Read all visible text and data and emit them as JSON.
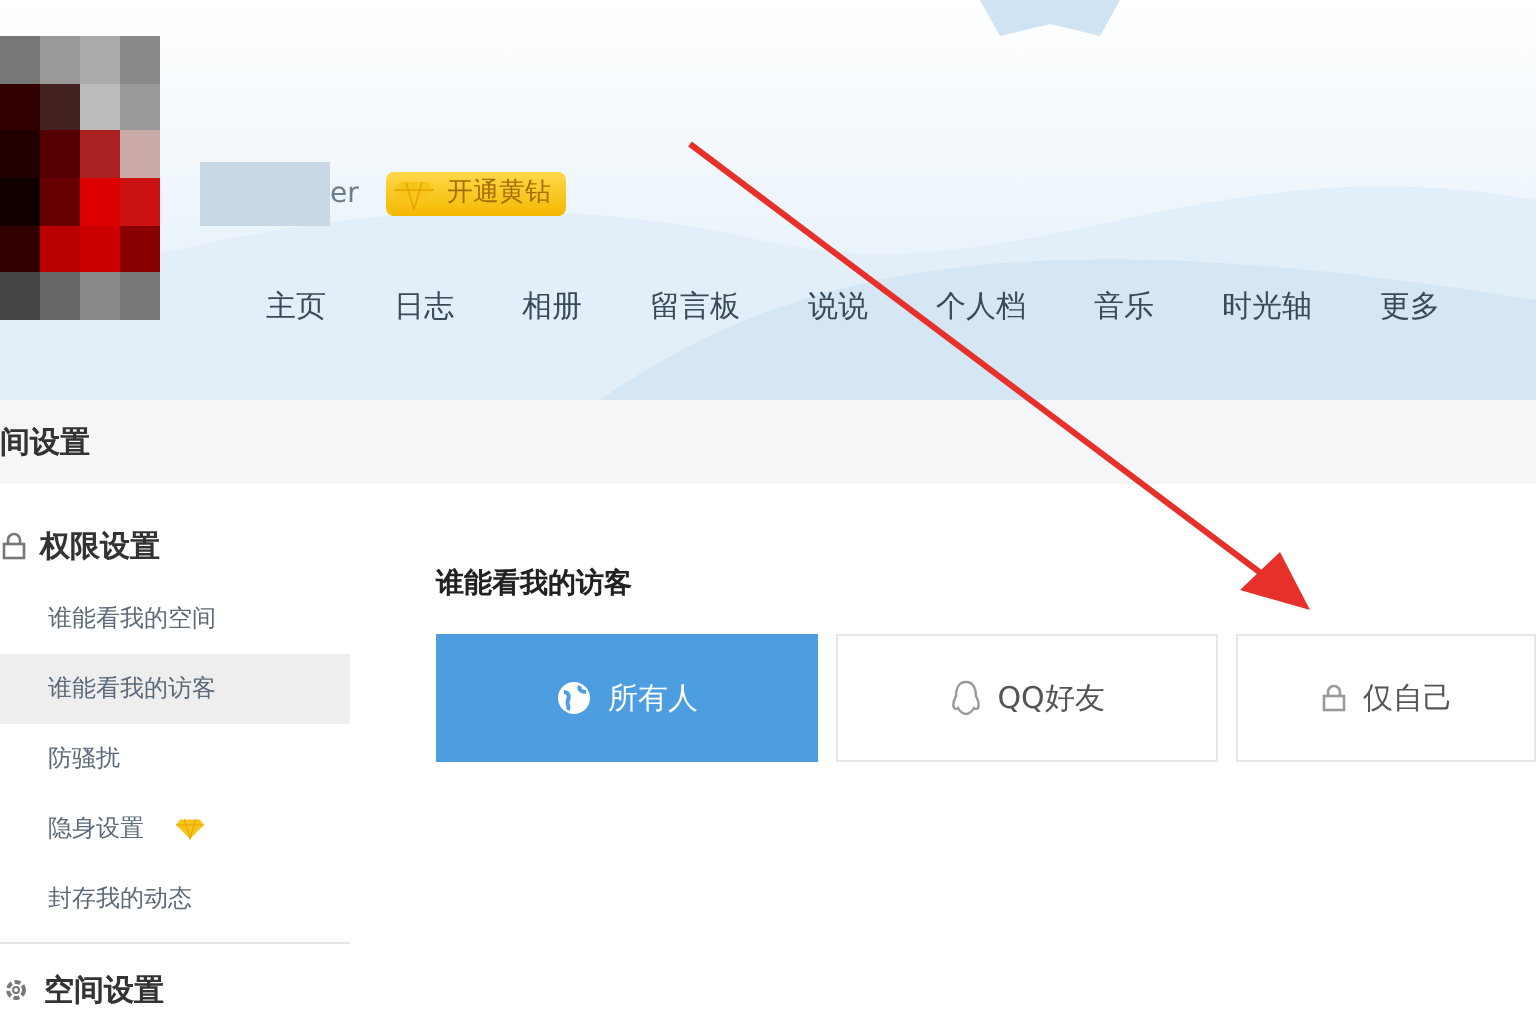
{
  "profile": {
    "name": "er",
    "badge": "开通黄钻"
  },
  "nav": [
    {
      "label": "主页"
    },
    {
      "label": "日志"
    },
    {
      "label": "相册"
    },
    {
      "label": "留言板"
    },
    {
      "label": "说说"
    },
    {
      "label": "个人档"
    },
    {
      "label": "音乐"
    },
    {
      "label": "时光轴"
    },
    {
      "label": "更多"
    }
  ],
  "page_title": "间设置",
  "sidebar": {
    "sections": [
      {
        "title": "权限设置",
        "items": [
          {
            "label": "谁能看我的空间",
            "selected": false,
            "vip": false
          },
          {
            "label": "谁能看我的访客",
            "selected": true,
            "vip": false
          },
          {
            "label": "防骚扰",
            "selected": false,
            "vip": false
          },
          {
            "label": "隐身设置",
            "selected": false,
            "vip": true
          },
          {
            "label": "封存我的动态",
            "selected": false,
            "vip": false
          }
        ]
      },
      {
        "title": "空间设置"
      }
    ]
  },
  "visitor_setting": {
    "title": "谁能看我的访客",
    "options": [
      {
        "label": "所有人",
        "selected": true
      },
      {
        "label": "QQ好友",
        "selected": false
      },
      {
        "label": "仅自己",
        "selected": false
      }
    ]
  }
}
